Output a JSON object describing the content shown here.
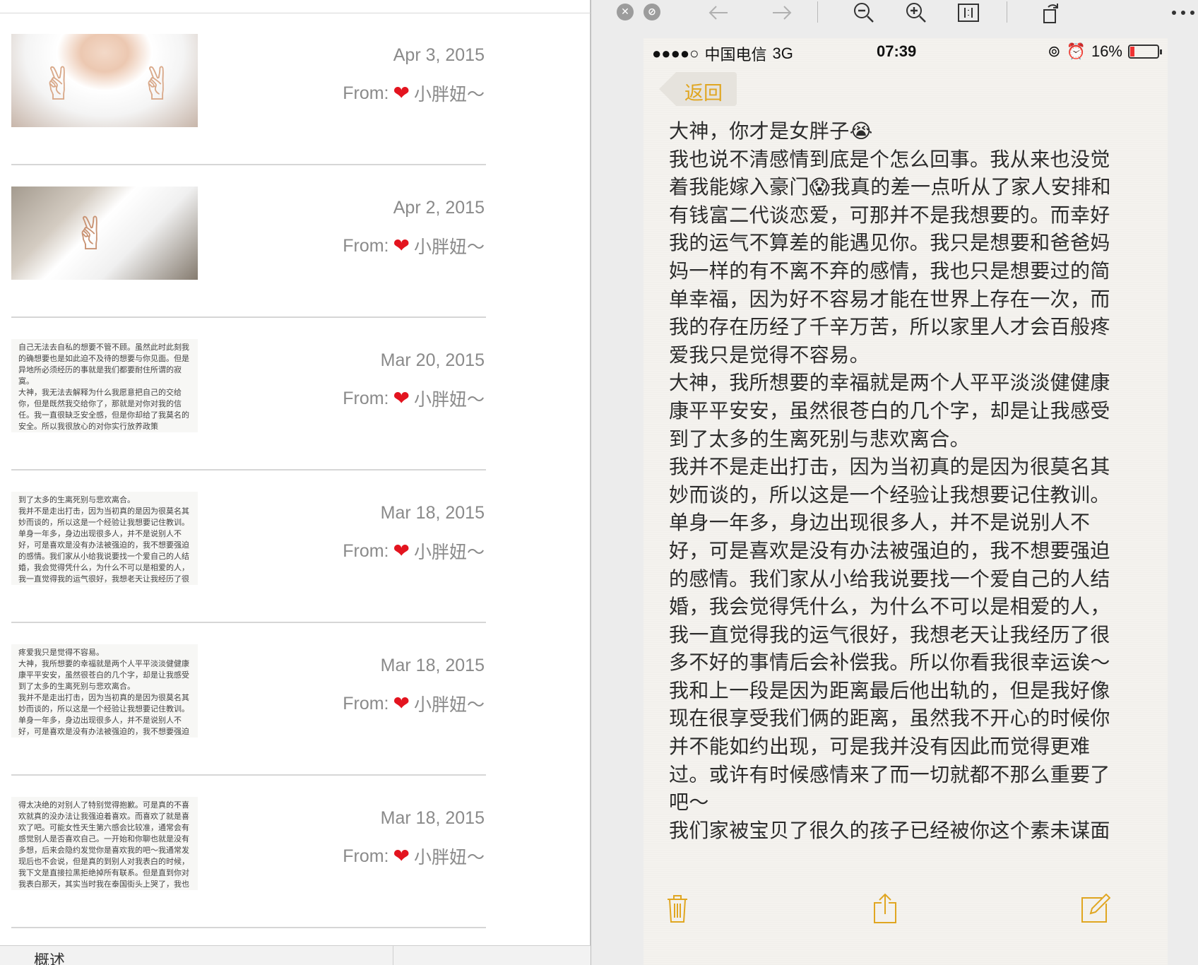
{
  "list": {
    "items": [
      {
        "date": "Apr 3, 2015",
        "from_label": "From:",
        "sender": "小胖妞～",
        "thumb": "photo",
        "thumb_text": ""
      },
      {
        "date": "Apr 2, 2015",
        "from_label": "From:",
        "sender": "小胖妞～",
        "thumb": "photo",
        "thumb_text": ""
      },
      {
        "date": "Mar 20, 2015",
        "from_label": "From:",
        "sender": "小胖妞～",
        "thumb": "text",
        "thumb_text": "自己无法去自私的想要不管不顾。虽然此时此刻我\n的确想要也是如此迫不及待的想要与你见面。但是\n异地所必须经历的事就是我们都要耐住所谓的寂\n寞。\n大神，我无法去解释为什么我愿意把自己的交给\n你，但是既然我交给你了，那就是对你对我的信\n任。我一直很缺乏安全感，但是你却给了我莫名的\n安全。所以我很放心的对你实行放养政策"
      },
      {
        "date": "Mar 18, 2015",
        "from_label": "From:",
        "sender": "小胖妞～",
        "thumb": "text",
        "thumb_text": "到了太多的生离死别与悲欢离合。\n我并不是走出打击，因为当初真的是因为很莫名其\n妙而谈的，所以这是一个经验让我想要记住教训。\n单身一年多，身边出现很多人，并不是说别人不\n好，可是喜欢是没有办法被强迫的，我不想要强迫\n的感情。我们家从小给我说要找一个爱自己的人结\n婚，我会觉得凭什么，为什么不可以是相爱的人，\n我一直觉得我的运气很好，我想老天让我经历了很"
      },
      {
        "date": "Mar 18, 2015",
        "from_label": "From:",
        "sender": "小胖妞～",
        "thumb": "text",
        "thumb_text": "疼爱我只是觉得不容易。\n大神，我所想要的幸福就是两个人平平淡淡健健康\n康平平安安，虽然很苍白的几个字，却是让我感受\n到了太多的生离死别与悲欢离合。\n我并不是走出打击，因为当初真的是因为很莫名其\n妙而谈的，所以这是一个经验让我想要记住教训。\n单身一年多，身边出现很多人，并不是说别人不\n好，可是喜欢是没有办法被强迫的，我不想要强迫\n的感情。我们家从小给我说要找一个爱自己的人结"
      },
      {
        "date": "Mar 18, 2015",
        "from_label": "From:",
        "sender": "小胖妞～",
        "thumb": "text",
        "thumb_text": "得太决绝的对别人了特别觉得抱歉。可是真的不喜\n欢就真的没办法让我强迫着喜欢。而喜欢了就是喜\n欢了吧。可能女性天生第六感会比较准，通常会有\n感觉别人是否喜欢自己。一开始和你聊也就是没有\n多想，后来会隐约发觉你是喜欢我的吧～我通常发\n现后也不会说，但是真的到别人对我表白的时候，\n我下文是直接拉黑拒绝掉所有联系。但是直到你对\n我表白那天，其实当时我在泰国街头上哭了，我也\n不知道为什么"
      }
    ]
  },
  "bottom_bar": {
    "label": "概述"
  },
  "phone": {
    "status": {
      "signal": "●●●●○",
      "carrier": "中国电信",
      "network": "3G",
      "time": "07:39",
      "battery": "16%",
      "battery_level": 0.16
    },
    "back_label": "返回",
    "note_paragraphs": [
      "大神，你才是女胖子😭",
      "我也说不清感情到底是个怎么回事。我从来也没觉着我能嫁入豪门😱我真的差一点听从了家人安排和有钱富二代谈恋爱，可那并不是我想要的。而幸好我的运气不算差的能遇见你。我只是想要和爸爸妈妈一样的有不离不弃的感情，我也只是想要过的简单幸福，因为好不容易才能在世界上存在一次，而我的存在历经了千辛万苦，所以家里人才会百般疼爱我只是觉得不容易。",
      "大神，我所想要的幸福就是两个人平平淡淡健健康康平平安安，虽然很苍白的几个字，却是让我感受到了太多的生离死别与悲欢离合。",
      "我并不是走出打击，因为当初真的是因为很莫名其妙而谈的，所以这是一个经验让我想要记住教训。单身一年多，身边出现很多人，并不是说别人不好，可是喜欢是没有办法被强迫的，我不想要强迫的感情。我们家从小给我说要找一个爱自己的人结婚，我会觉得凭什么，为什么不可以是相爱的人，我一直觉得我的运气很好，我想老天让我经历了很多不好的事情后会补偿我。所以你看我很幸运诶～",
      "我和上一段是因为距离最后他出轨的，但是我好像现在很享受我们俩的距离，虽然我不开心的时候你并不能如约出现，可是我并没有因此而觉得更难过。或许有时候感情来了而一切就都不那么重要了吧～",
      "我们家被宝贝了很久的孩子已经被你这个素未谋面"
    ]
  },
  "colors": {
    "accent": "#e0a621",
    "heart": "#e3141f",
    "meta_text": "#8a8a8a"
  }
}
